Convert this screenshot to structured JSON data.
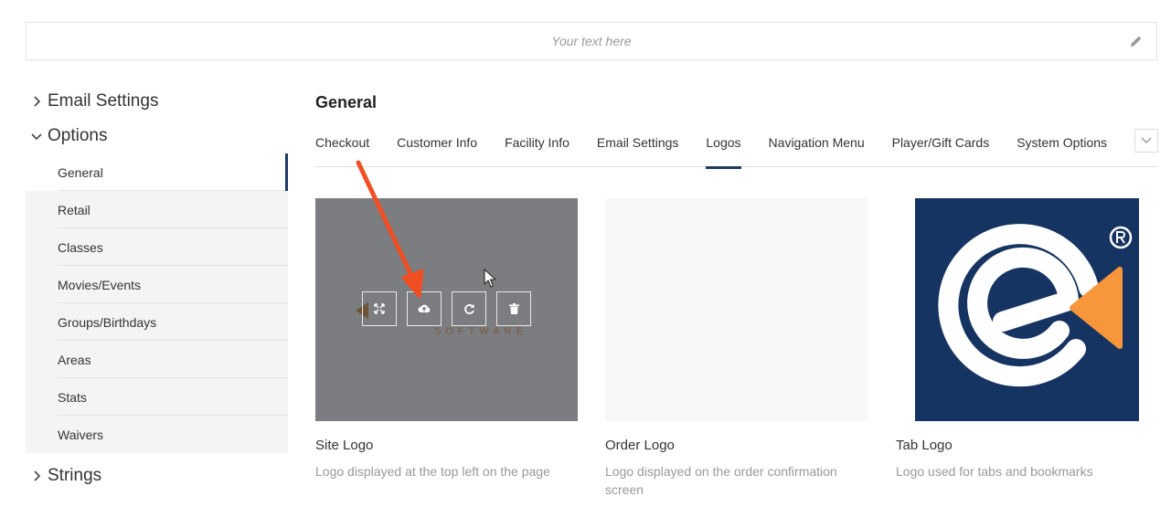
{
  "header": {
    "placeholder": "Your text here"
  },
  "sidebar": {
    "sections_top": [
      {
        "label": "Email Settings",
        "expanded": false
      },
      {
        "label": "Options",
        "expanded": true
      }
    ],
    "items": [
      {
        "label": "General",
        "active": true
      },
      {
        "label": "Retail"
      },
      {
        "label": "Classes"
      },
      {
        "label": "Movies/Events"
      },
      {
        "label": "Groups/Birthdays"
      },
      {
        "label": "Areas"
      },
      {
        "label": "Stats"
      },
      {
        "label": "Waivers"
      }
    ],
    "sections_bottom": [
      {
        "label": "Strings",
        "expanded": false
      }
    ]
  },
  "main": {
    "title": "General",
    "tabs": [
      {
        "label": "Checkout"
      },
      {
        "label": "Customer Info"
      },
      {
        "label": "Facility Info"
      },
      {
        "label": "Email Settings"
      },
      {
        "label": "Logos",
        "active": true
      },
      {
        "label": "Navigation Menu"
      },
      {
        "label": "Player/Gift Cards"
      },
      {
        "label": "System Options"
      }
    ],
    "cards": [
      {
        "title": "Site Logo",
        "desc": "Logo displayed at the top left on the page",
        "brand_word": "SOFTWARE"
      },
      {
        "title": "Order Logo",
        "desc": "Logo displayed on the order confirmation screen"
      },
      {
        "title": "Tab Logo",
        "desc": "Logo used for tabs and bookmarks"
      }
    ]
  },
  "colors": {
    "accent": "#1f3a60",
    "logo_bg": "#163461",
    "logo_orange": "#f7963b",
    "annotation_arrow": "#f04e23",
    "overlay": "#7b7d80"
  },
  "icons": [
    "pencil-icon",
    "chevron-right-icon",
    "chevron-down-icon",
    "expand-icon",
    "upload-cloud-icon",
    "refresh-icon",
    "trash-icon"
  ]
}
